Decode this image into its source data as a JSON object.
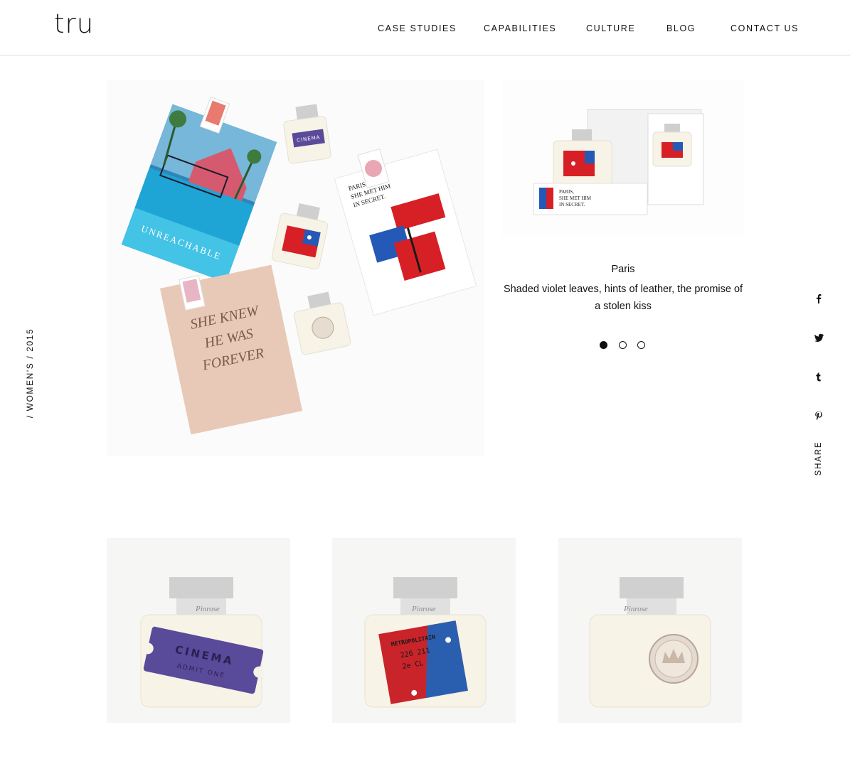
{
  "header": {
    "logo": "tru",
    "nav": [
      {
        "label": "CASE STUDIES"
      },
      {
        "label": "CAPABILITIES"
      },
      {
        "label": "CULTURE"
      },
      {
        "label": "BLOG"
      },
      {
        "label": "CONTACT US"
      }
    ]
  },
  "side": {
    "category": "/ WOMEN'S / 2015"
  },
  "share": {
    "label": "SHARE",
    "icons": [
      "facebook-icon",
      "twitter-icon",
      "tumblr-icon",
      "pinterest-icon"
    ]
  },
  "hero": {
    "image": "perfume-packaging-collection-photo",
    "box_texts": {
      "cinema_label": "CINEMA",
      "admit": "ADMIT ONE",
      "unreachable": "UNREACHABLE",
      "paris_line1": "PARIS,",
      "paris_line2": "SHE MET HIM",
      "paris_line3": "IN SECRET.",
      "knew_line1": "SHE KNEW",
      "knew_line2": "HE WAS",
      "knew_line3": "FOREVER"
    }
  },
  "slideshow": {
    "title": "Paris",
    "description": "Shaded violet leaves, hints of leather, the promise of a stolen kiss",
    "active_index": 0,
    "slide_count": 3,
    "box_texts": {
      "line1": "PARIS,",
      "line2": "SHE MET HIM",
      "line3": "IN SECRET."
    }
  },
  "products": [
    {
      "name": "cinema-bottle",
      "label_line1": "CINEMA",
      "label_line2": "ADMIT ONE",
      "brand": "Pinrose",
      "color": "#5a4a9a"
    },
    {
      "name": "metropolitain-bottle",
      "label_line1": "METROPOLITAIN",
      "label_line2": "226 211",
      "label_line3": "2e CL",
      "brand": "Pinrose",
      "color": "#c8242a",
      "accent": "#2a5fb0"
    },
    {
      "name": "crown-bottle",
      "label_line1": "",
      "brand": "Pinrose",
      "color": "#c9b7a7"
    }
  ],
  "colors": {
    "text": "#111111",
    "divider": "#d6d6d6",
    "bottle_glass": "#f7f3e6",
    "cap": "#c9c9c9"
  }
}
